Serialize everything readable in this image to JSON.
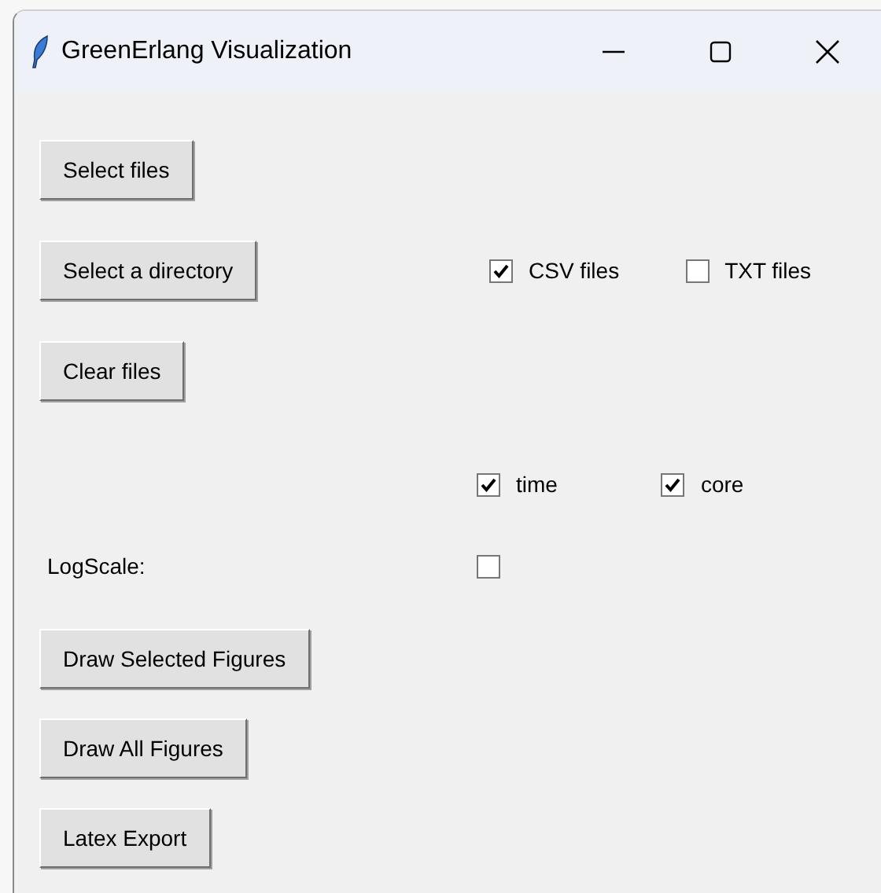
{
  "window": {
    "title": "GreenErlang Visualization"
  },
  "top_buttons": [
    {
      "label": "Select files"
    },
    {
      "label": "Select a directory"
    },
    {
      "label": "Clear files"
    }
  ],
  "file_types": [
    {
      "label": "CSV files",
      "checked": true
    },
    {
      "label": "TXT files",
      "checked": false
    }
  ],
  "metrics": [
    {
      "label": "time",
      "checked": true
    },
    {
      "label": "core",
      "checked": true
    }
  ],
  "logscale": {
    "label": "LogScale:",
    "checked": false
  },
  "bottom_buttons": [
    {
      "label": "Draw Selected Figures"
    },
    {
      "label": "Draw All Figures"
    },
    {
      "label": "Latex Export"
    }
  ]
}
